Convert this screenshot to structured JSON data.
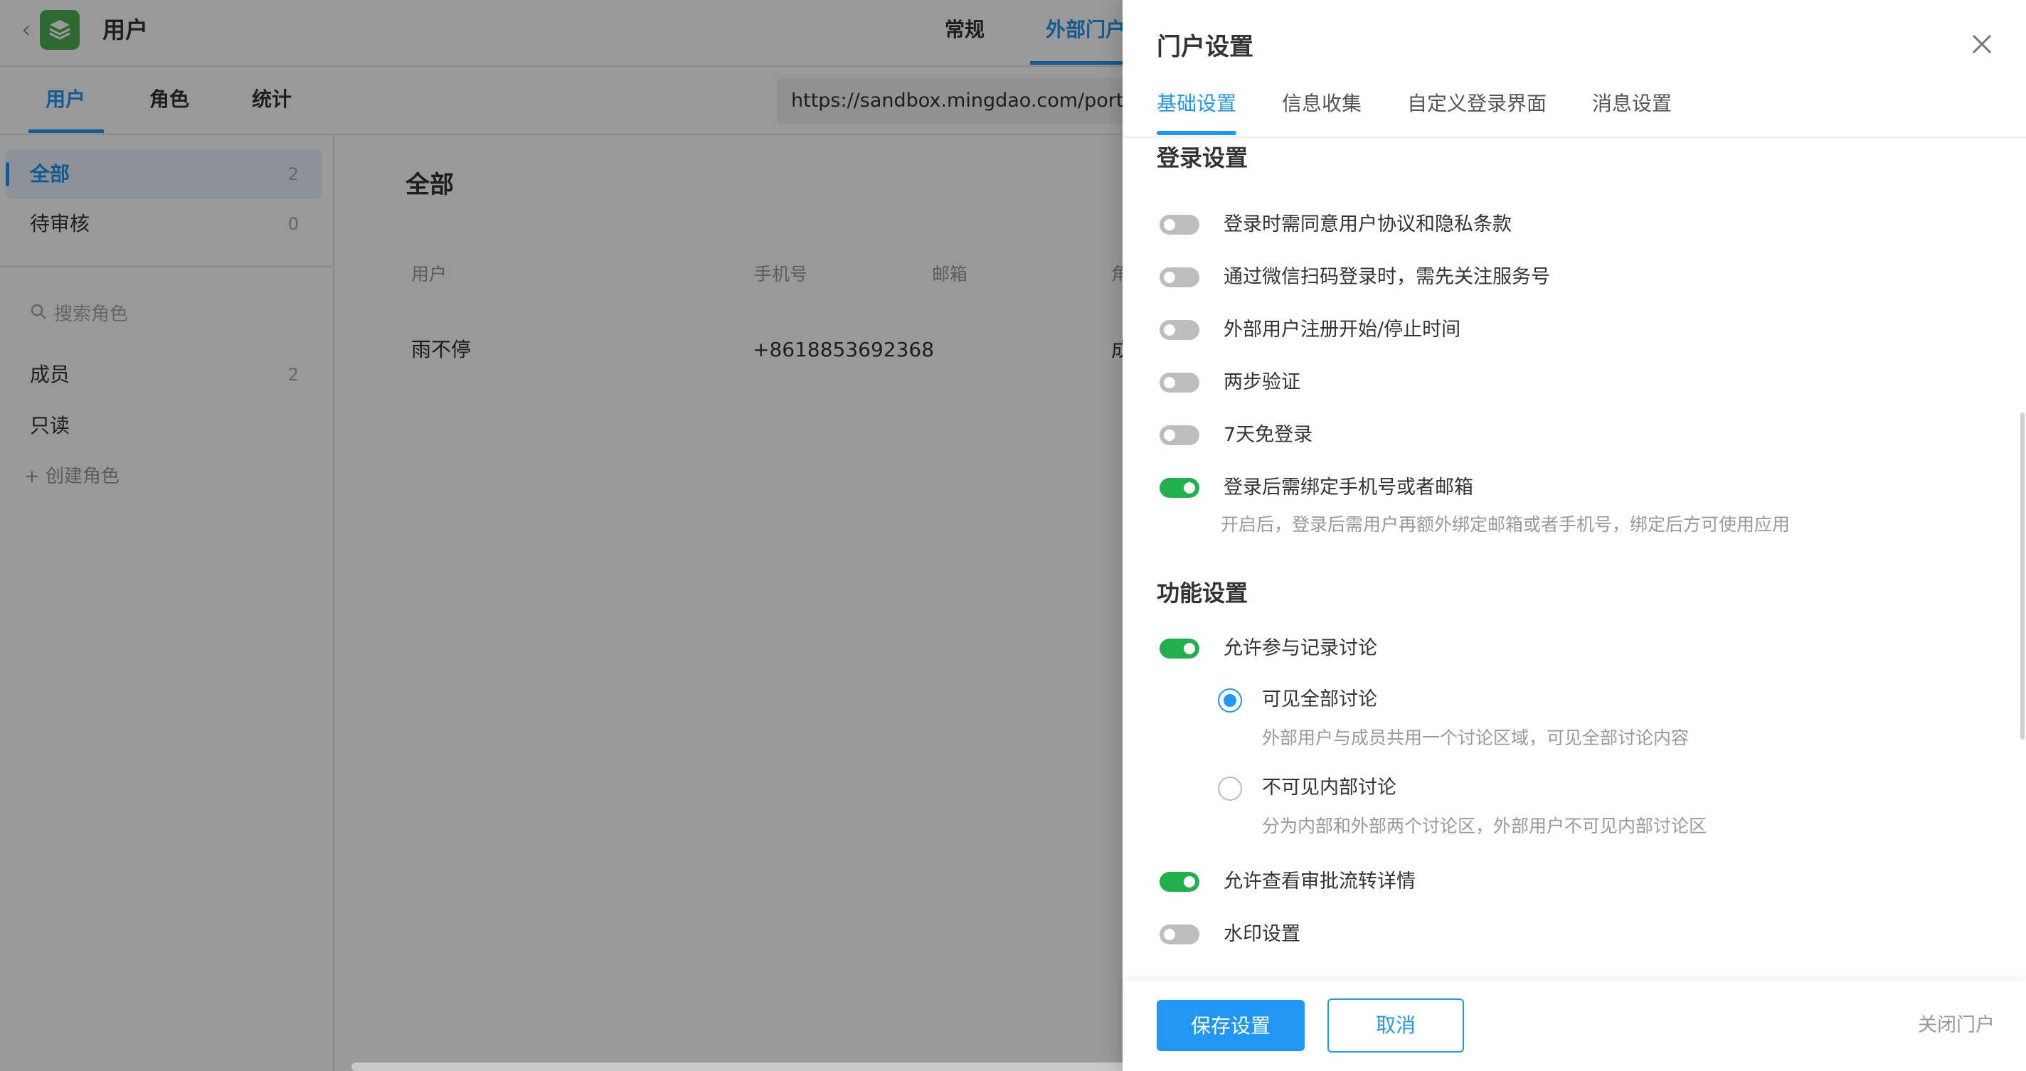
{
  "app": {
    "title": "用户",
    "top_tabs": [
      "常规",
      "外部门户"
    ],
    "sub_tabs": [
      "用户",
      "角色",
      "统计"
    ],
    "portal_url": "https://sandbox.mingdao.com/portal/"
  },
  "sidebar": {
    "groups": [
      {
        "label": "全部",
        "count": "2"
      },
      {
        "label": "待审核",
        "count": "0"
      }
    ],
    "search_placeholder": "搜索角色",
    "roles": [
      {
        "label": "成员",
        "count": "2"
      },
      {
        "label": "只读",
        "count": ""
      }
    ],
    "create_role": "+ 创建角色"
  },
  "main": {
    "title": "全部",
    "columns": [
      "用户",
      "手机号",
      "邮箱",
      "角"
    ],
    "rows": [
      {
        "user": "雨不停",
        "phone": "+8618853692368",
        "email": "",
        "role": "成"
      }
    ]
  },
  "drawer": {
    "title": "门户设置",
    "tabs": [
      "基础设置",
      "信息收集",
      "自定义登录界面",
      "消息设置"
    ],
    "login_section": {
      "title": "登录设置",
      "items": [
        {
          "label": "登录时需同意用户协议和隐私条款",
          "on": false
        },
        {
          "label": "通过微信扫码登录时，需先关注服务号",
          "on": false
        },
        {
          "label": "外部用户注册开始/停止时间",
          "on": false
        },
        {
          "label": "两步验证",
          "on": false
        },
        {
          "label": "7天免登录",
          "on": false
        },
        {
          "label": "登录后需绑定手机号或者邮箱",
          "on": true,
          "desc": "开启后，登录后需用户再额外绑定邮箱或者手机号，绑定后方可使用应用"
        }
      ]
    },
    "feature_section": {
      "title": "功能设置",
      "discussion": {
        "label": "允许参与记录讨论",
        "on": true,
        "options": [
          {
            "label": "可见全部讨论",
            "desc": "外部用户与成员共用一个讨论区域，可见全部讨论内容",
            "selected": true
          },
          {
            "label": "不可见内部讨论",
            "desc": "分为内部和外部两个讨论区，外部用户不可见内部讨论区",
            "selected": false
          }
        ]
      },
      "items": [
        {
          "label": "允许查看审批流转详情",
          "on": true
        },
        {
          "label": "水印设置",
          "on": false
        }
      ]
    },
    "footer": {
      "save": "保存设置",
      "cancel": "取消",
      "close_portal": "关闭门户"
    }
  },
  "colors": {
    "accent": "#2196f3",
    "toggle_on": "#21b04b",
    "toggle_off": "#bdbdbd"
  }
}
